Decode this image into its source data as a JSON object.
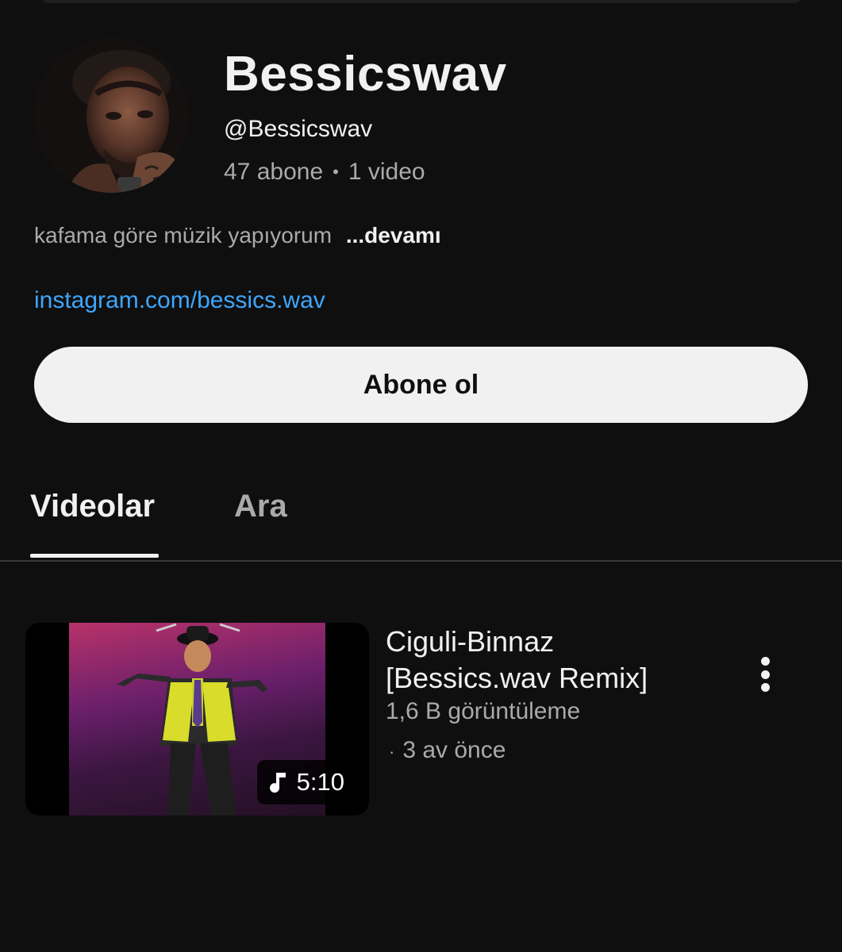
{
  "channel": {
    "name": "Bessicswav",
    "handle": "@Bessicswav",
    "subscribers": "47 abone",
    "separator": "•",
    "video_count": "1 video",
    "description": "kafama göre müzik yapıyorum",
    "description_more": "...devamı",
    "link": "instagram.com/bessics.wav",
    "subscribe_label": "Abone ol"
  },
  "tabs": [
    {
      "label": "Videolar",
      "active": true
    },
    {
      "label": "Ara",
      "active": false
    }
  ],
  "videos": [
    {
      "title": "Ciguli-Binnaz [Bessics.wav Remix]",
      "views": "1,6 B görüntüleme",
      "age_separator": "·",
      "age": "3 av önce",
      "duration": "5:10",
      "duration_icon": "music-note-icon",
      "menu_icon": "more-vert-icon"
    }
  ],
  "colors": {
    "background": "#0f0f0f",
    "text_primary": "#f1f1f1",
    "text_secondary": "#aaaaaa",
    "link": "#3ea6ff",
    "button_bg": "#f1f1f1"
  }
}
